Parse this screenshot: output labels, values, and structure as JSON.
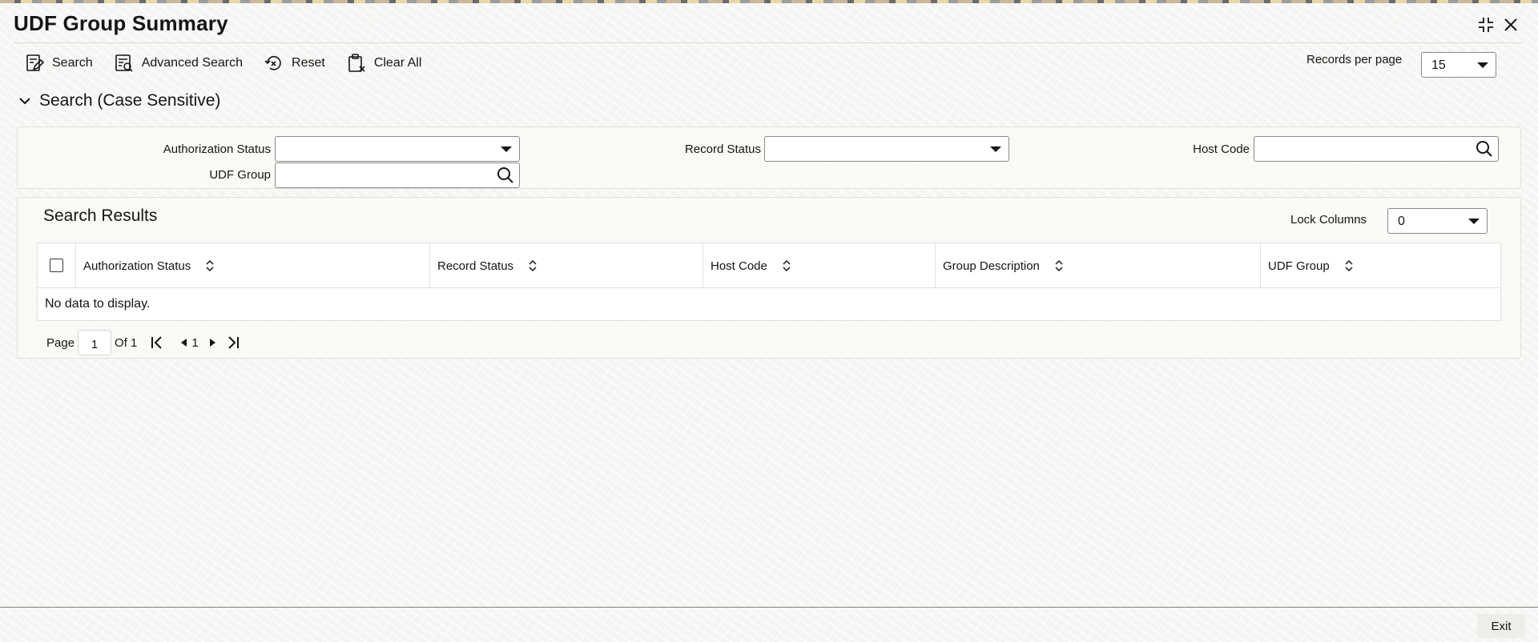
{
  "window": {
    "title": "UDF Group Summary",
    "controls": {
      "minimize_icon": "collapse-arrows-icon",
      "close_icon": "close-icon"
    }
  },
  "toolbar": {
    "search_label": "Search",
    "advanced_search_label": "Advanced Search",
    "reset_label": "Reset",
    "clear_all_label": "Clear All"
  },
  "records_per_page": {
    "label": "Records per page",
    "value": "15"
  },
  "search_section": {
    "title": "Search (Case Sensitive)",
    "fields": {
      "authorization_status": {
        "label": "Authorization Status",
        "value": ""
      },
      "record_status": {
        "label": "Record Status",
        "value": ""
      },
      "host_code": {
        "label": "Host Code",
        "value": ""
      },
      "udf_group": {
        "label": "UDF Group",
        "value": ""
      }
    }
  },
  "results": {
    "title": "Search Results",
    "lock_columns": {
      "label": "Lock Columns",
      "value": "0"
    },
    "columns": [
      "Authorization Status",
      "Record Status",
      "Host Code",
      "Group Description",
      "UDF Group"
    ],
    "rows": [],
    "empty_text": "No data to display."
  },
  "pagination": {
    "page_label": "Page",
    "current_page": "1",
    "of_label": "Of 1",
    "page_number": "1"
  },
  "footer": {
    "exit_label": "Exit"
  },
  "colors": {
    "background": "#f5f4f2",
    "text": "#161513",
    "border": "#e2e0dc"
  }
}
